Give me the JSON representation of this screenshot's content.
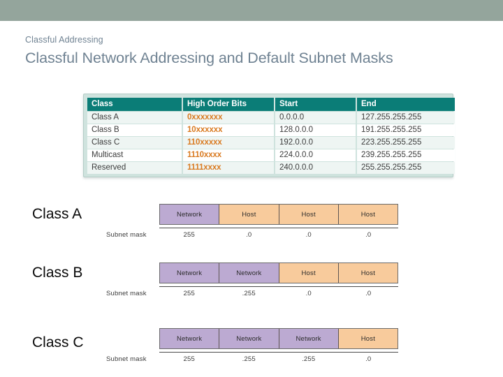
{
  "header": {
    "bar_color": "#94a59c",
    "eyebrow": "Classful Addressing",
    "title": "Classful Network Addressing and Default Subnet Masks",
    "title_color": "#6f8292"
  },
  "class_table": {
    "header_bg": "#0b7d77",
    "bits_color": "#d9791f",
    "frame_color": "#cfe3de",
    "columns": [
      "Class",
      "High Order Bits",
      "Start",
      "End"
    ],
    "rows": [
      {
        "class": "Class A",
        "bits": "0xxxxxxx",
        "start": "0.0.0.0",
        "end": "127.255.255.255"
      },
      {
        "class": "Class B",
        "bits": "10xxxxxx",
        "start": "128.0.0.0",
        "end": "191.255.255.255"
      },
      {
        "class": "Class C",
        "bits": "110xxxxx",
        "start": "192.0.0.0",
        "end": "223.255.255.255"
      },
      {
        "class": "Multicast",
        "bits": "1110xxxx",
        "start": "224.0.0.0",
        "end": "239.255.255.255"
      },
      {
        "class": "Reserved",
        "bits": "1111xxxx",
        "start": "240.0.0.0",
        "end": "255.255.255.255"
      }
    ]
  },
  "diagrams": {
    "mask_label": "Subnet mask",
    "network_color": "#bcaad2",
    "host_color": "#f8cb9c",
    "classes": [
      {
        "label": "Class A",
        "octets": [
          {
            "text": "Network",
            "type": "network"
          },
          {
            "text": "Host",
            "type": "host"
          },
          {
            "text": "Host",
            "type": "host"
          },
          {
            "text": "Host",
            "type": "host"
          }
        ],
        "mask": [
          "255",
          ".0",
          ".0",
          ".0"
        ]
      },
      {
        "label": "Class B",
        "octets": [
          {
            "text": "Network",
            "type": "network"
          },
          {
            "text": "Network",
            "type": "network"
          },
          {
            "text": "Host",
            "type": "host"
          },
          {
            "text": "Host",
            "type": "host"
          }
        ],
        "mask": [
          "255",
          ".255",
          ".0",
          ".0"
        ]
      },
      {
        "label": "Class C",
        "octets": [
          {
            "text": "Network",
            "type": "network"
          },
          {
            "text": "Network",
            "type": "network"
          },
          {
            "text": "Network",
            "type": "network"
          },
          {
            "text": "Host",
            "type": "host"
          }
        ],
        "mask": [
          "255",
          ".255",
          ".255",
          ".0"
        ]
      }
    ]
  }
}
